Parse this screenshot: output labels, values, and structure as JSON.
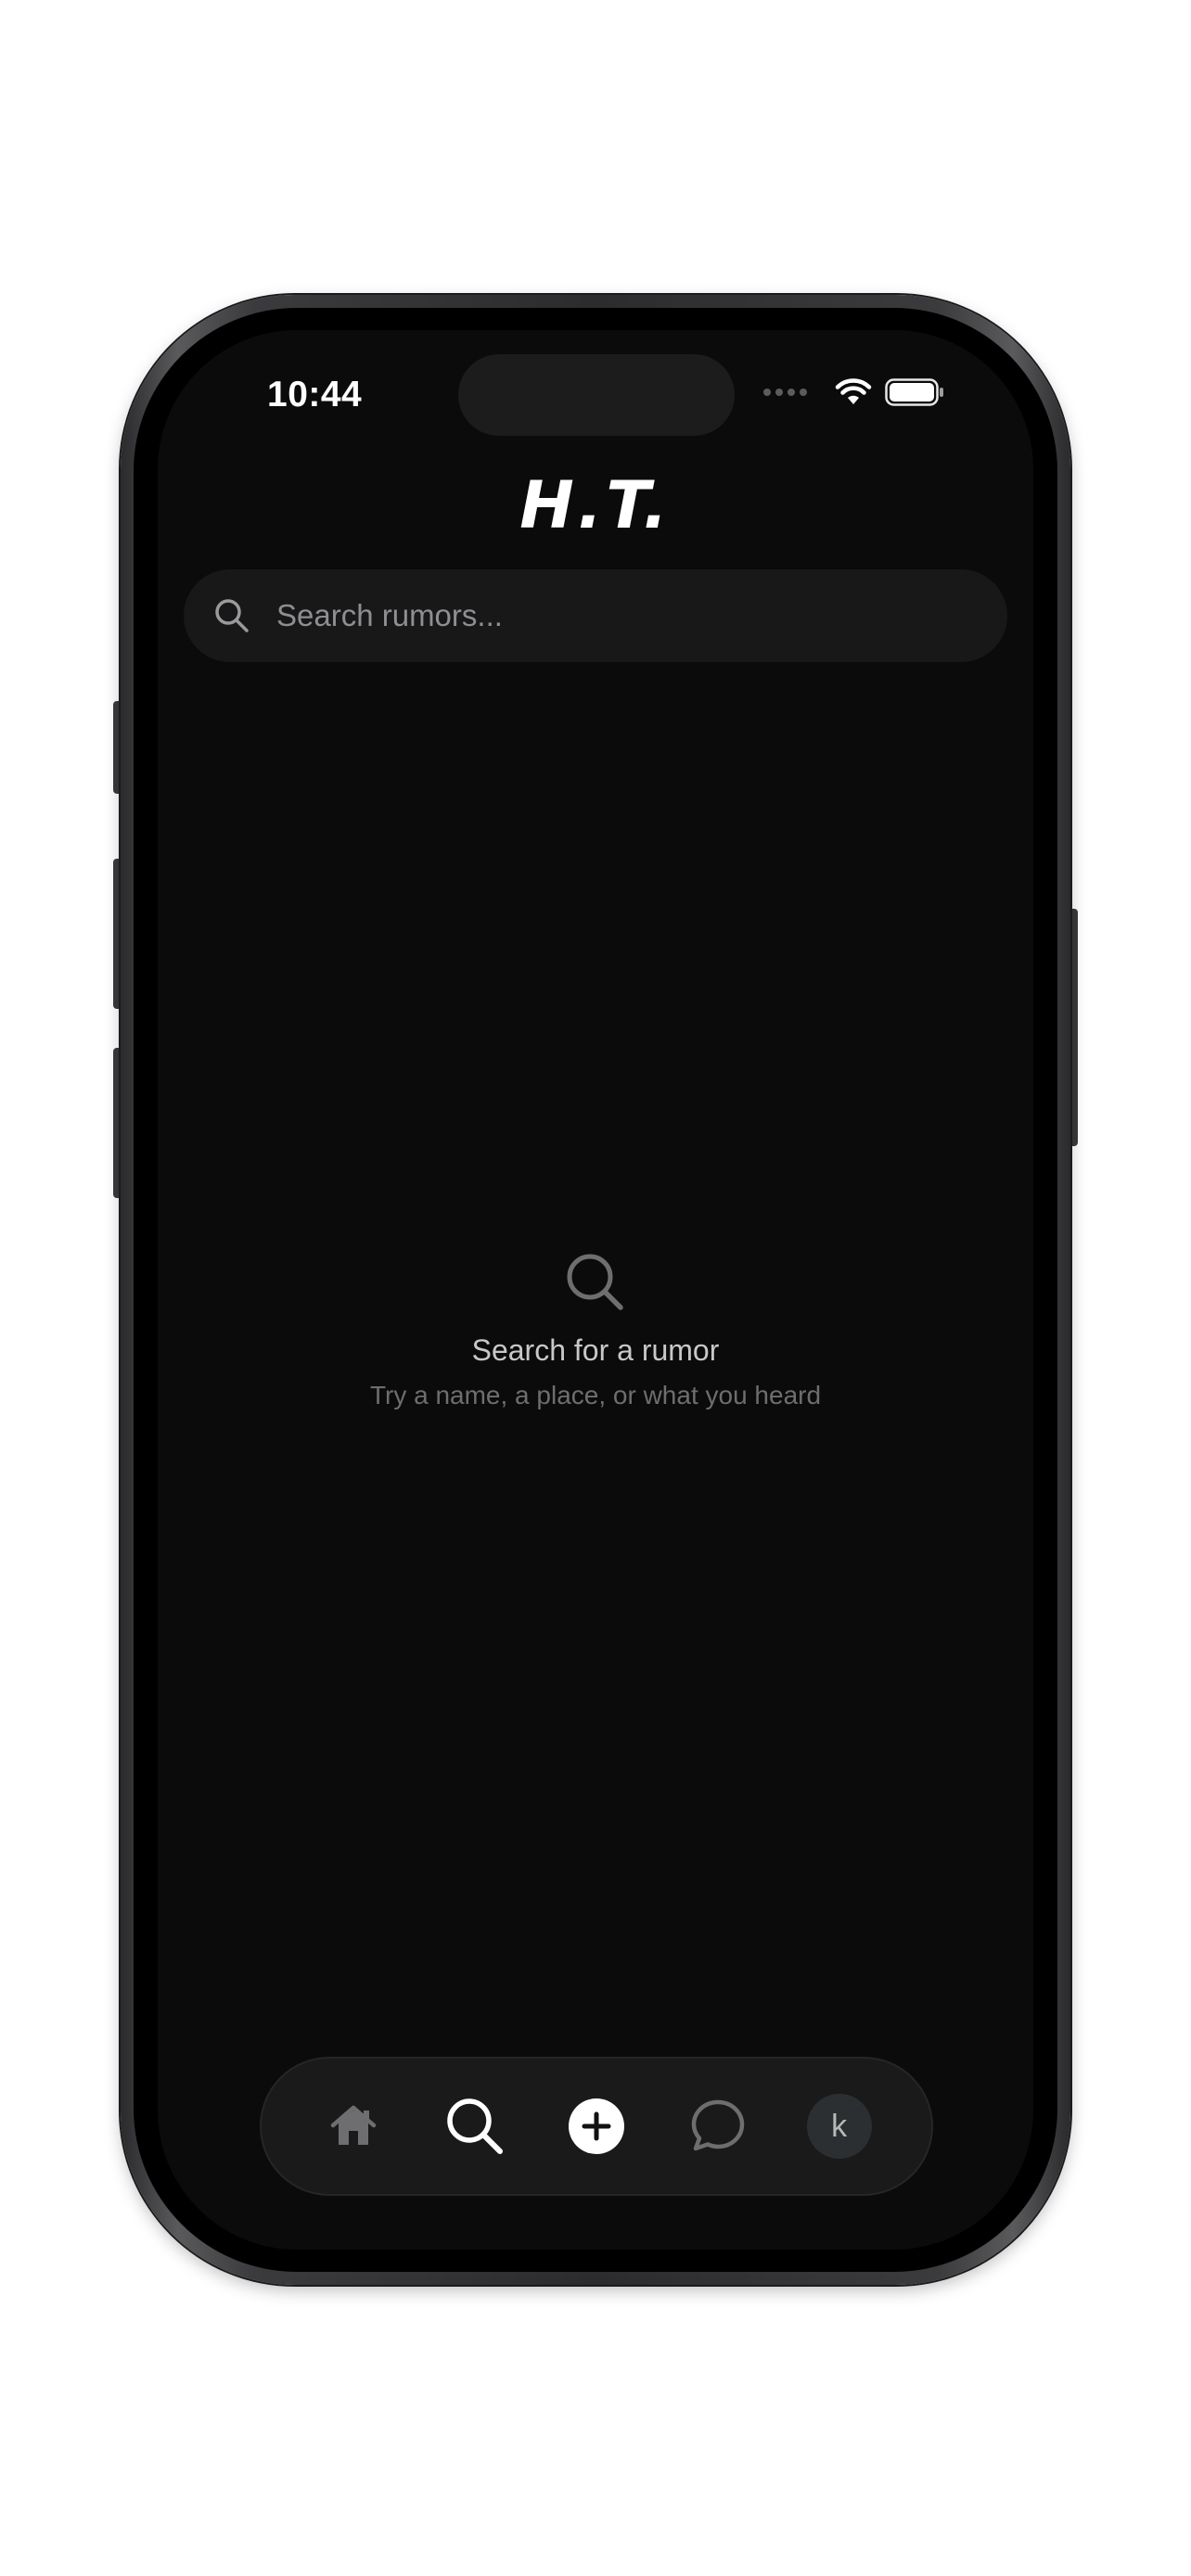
{
  "status_bar": {
    "time": "10:44"
  },
  "header": {
    "logo_text": "H.T."
  },
  "search": {
    "placeholder": "Search rumors...",
    "value": ""
  },
  "empty_state": {
    "icon": "search-icon",
    "title": "Search for a rumor",
    "subtitle": "Try a name, a place, or what you heard"
  },
  "tab_bar": {
    "items": [
      {
        "name": "home",
        "icon": "home-icon",
        "active": false
      },
      {
        "name": "search",
        "icon": "search-icon",
        "active": true
      },
      {
        "name": "create",
        "icon": "plus-circle-icon",
        "active": false
      },
      {
        "name": "messages",
        "icon": "chat-bubble-icon",
        "active": false
      },
      {
        "name": "profile",
        "icon": "avatar",
        "label": "k",
        "active": false
      }
    ]
  },
  "colors": {
    "background": "#0b0b0b",
    "search_field": "#181818",
    "tab_bar": "#1a1a1a",
    "active_icon": "#ffffff",
    "inactive_icon": "#6e6e70"
  }
}
